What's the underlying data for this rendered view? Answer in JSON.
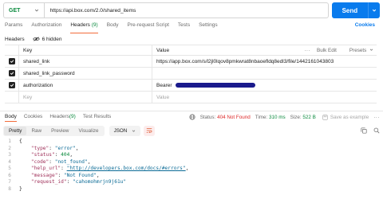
{
  "request": {
    "method": "GET",
    "url": "https://api.box.com/2.0/shared_items",
    "send_label": "Send"
  },
  "request_tabs": [
    {
      "label": "Params"
    },
    {
      "label": "Authorization"
    },
    {
      "label": "Headers",
      "count": "(9)"
    },
    {
      "label": "Body"
    },
    {
      "label": "Pre-request Script"
    },
    {
      "label": "Tests"
    },
    {
      "label": "Settings"
    }
  ],
  "cookies_label": "Cookies",
  "headers_section": {
    "title": "Headers",
    "hidden_label": "6 hidden"
  },
  "table": {
    "key_header": "Key",
    "value_header": "Value",
    "more_label": "···",
    "bulk_edit": "Bulk Edit",
    "presets": "Presets",
    "rows": [
      {
        "key": "shared_link",
        "value": "https://app.box.com/s/l2jl0lqov8pmkwrat8nbaoefldq8edl3/file/1442161043803"
      },
      {
        "key": "shared_link_password",
        "value": ""
      },
      {
        "key": "authorization",
        "value": "Bearer"
      }
    ],
    "placeholder_key": "Key",
    "placeholder_value": "Value"
  },
  "response_tabs": [
    {
      "label": "Body"
    },
    {
      "label": "Cookies"
    },
    {
      "label": "Headers",
      "count": "(9)"
    },
    {
      "label": "Test Results"
    }
  ],
  "response_status": {
    "status_label": "Status:",
    "status_value": "404 Not Found",
    "time_label": "Time:",
    "time_value": "310 ms",
    "size_label": "Size:",
    "size_value": "522 B",
    "save_label": "Save as example"
  },
  "formats": [
    "Pretty",
    "Raw",
    "Preview",
    "Visualize"
  ],
  "json_label": "JSON",
  "code_lines": [
    {
      "num": "1",
      "text": "{"
    },
    {
      "num": "2",
      "key": "\"type\"",
      "val": "\"error\"",
      "kind": "s"
    },
    {
      "num": "3",
      "key": "\"status\"",
      "val": "404",
      "kind": "n"
    },
    {
      "num": "4",
      "key": "\"code\"",
      "val": "\"not_found\"",
      "kind": "s"
    },
    {
      "num": "5",
      "key": "\"help_url\"",
      "val": "\"http://developers.box.com/docs/#errors\"",
      "kind": "u"
    },
    {
      "num": "6",
      "key": "\"message\"",
      "val": "\"Not Found\"",
      "kind": "s"
    },
    {
      "num": "7",
      "key": "\"request_id\"",
      "val": "\"cahomohmrjn9j61u\"",
      "kind": "s",
      "last": true
    },
    {
      "num": "8",
      "text": "}"
    }
  ],
  "colors": {
    "accent": "#097bed",
    "tab_underline": "#f26b3a",
    "status_error": "#dd2929",
    "ok_green": "#0b8a3e"
  }
}
